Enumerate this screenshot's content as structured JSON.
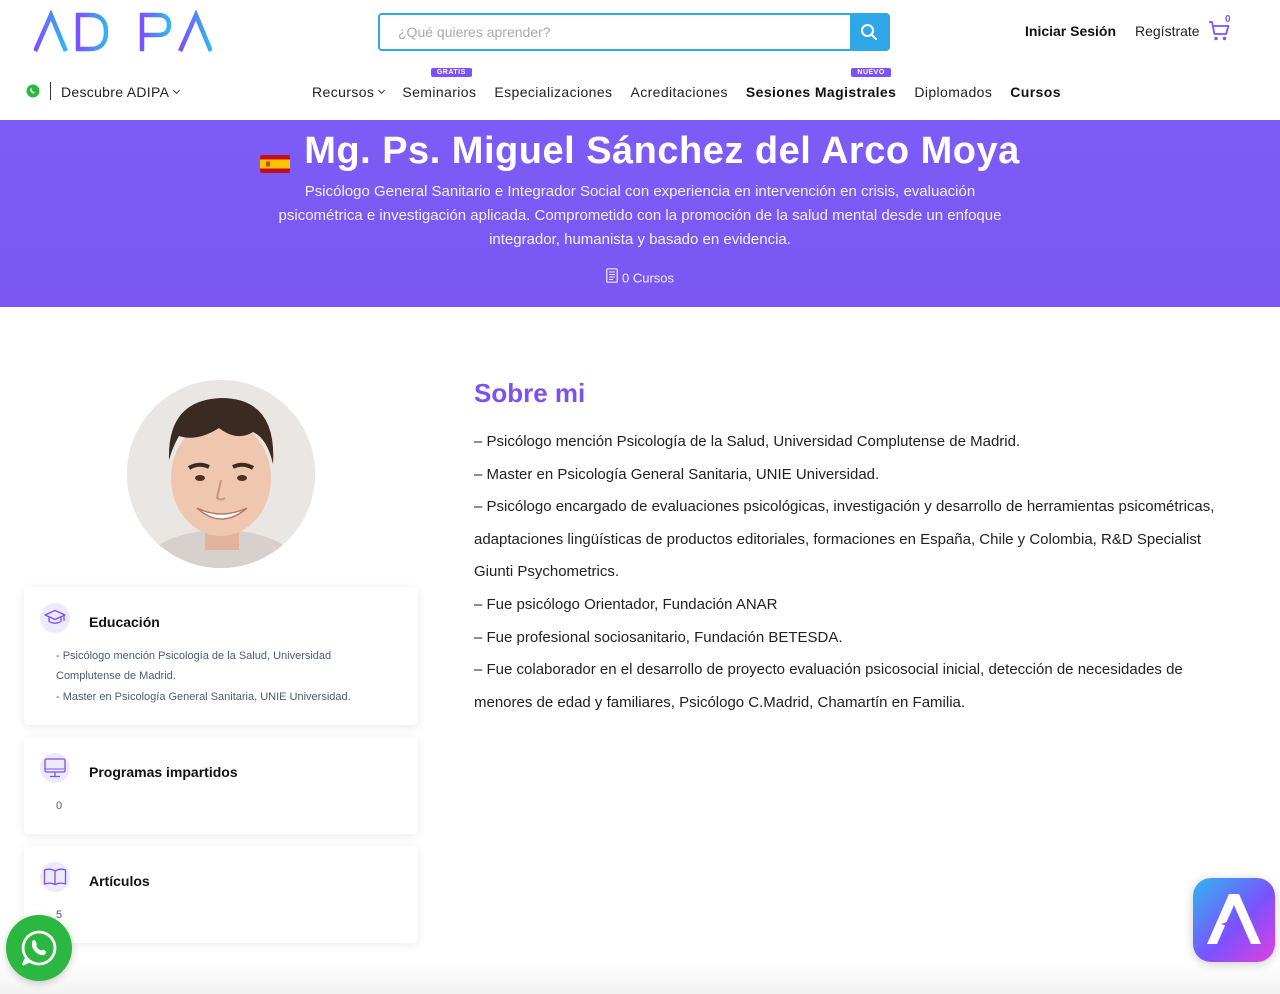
{
  "header": {
    "logo_text": "ADIPA",
    "search_placeholder": "¿Qué quieres aprender?",
    "login_label": "Iniciar Sesión",
    "register_label": "Regístrate",
    "cart_count": "0"
  },
  "nav": {
    "discover_label": "Descubre ADIPA",
    "items": [
      {
        "label": "Recursos",
        "dropdown": true,
        "bold": false,
        "badge": ""
      },
      {
        "label": "Seminarios",
        "dropdown": false,
        "bold": false,
        "badge": "GRATIS"
      },
      {
        "label": "Especializaciones",
        "dropdown": false,
        "bold": false,
        "badge": ""
      },
      {
        "label": "Acreditaciones",
        "dropdown": false,
        "bold": false,
        "badge": ""
      },
      {
        "label": "Sesiones Magistrales",
        "dropdown": false,
        "bold": true,
        "badge": "NUEVO"
      },
      {
        "label": "Diplomados",
        "dropdown": false,
        "bold": false,
        "badge": ""
      },
      {
        "label": "Cursos",
        "dropdown": false,
        "bold": true,
        "badge": ""
      }
    ]
  },
  "hero": {
    "name": "Mg. Ps. Miguel Sánchez del Arco Moya",
    "description": "Psicólogo General Sanitario e Integrador Social con experiencia en intervención en crisis, evaluación psicométrica e investigación aplicada. Comprometido con la promoción de la salud mental desde un enfoque integrador, humanista y basado en evidencia.",
    "courses_label": "0 Cursos"
  },
  "cards": {
    "education": {
      "title": "Educación",
      "lines": [
        "- Psicólogo mención Psicología de la Salud, Universidad Complutense de Madrid.",
        "- Master en Psicología General Sanitaria, UNIE Universidad."
      ]
    },
    "programs": {
      "title": "Programas impartidos",
      "count": "0"
    },
    "articles": {
      "title": "Artículos",
      "count": "5"
    }
  },
  "about": {
    "title": "Sobre mi",
    "paragraphs": [
      "– Psicólogo mención Psicología de la Salud, Universidad Complutense de Madrid.",
      "– Master en Psicología General Sanitaria, UNIE Universidad.",
      "– Psicólogo encargado de evaluaciones psicológicas, investigación y desarrollo de herramientas psicométricas, adaptaciones lingüísticas de productos editoriales, formaciones en España, Chile y Colombia, R&D Specialist Giunti Psychometrics.",
      "– Fue psicólogo Orientador, Fundación ANAR",
      "– Fue profesional sociosanitario, Fundación BETESDA.",
      "– Fue colaborador en el desarrollo de proyecto evaluación psicosocial inicial, detección de necesidades de menores de edad y familiares, Psicólogo C.Madrid, Chamartín en Familia."
    ]
  },
  "colors": {
    "brand_purple": "#7a52f0",
    "hero_bg": "#7c5cf6",
    "search_blue": "#2fa6e6",
    "whatsapp_green": "#2bb741"
  },
  "icons": [
    "search-icon",
    "cart-icon",
    "whatsapp-icon",
    "flag-spain-icon",
    "document-icon",
    "graduation-cap-icon",
    "monitor-icon",
    "open-book-icon",
    "assistant-icon"
  ]
}
